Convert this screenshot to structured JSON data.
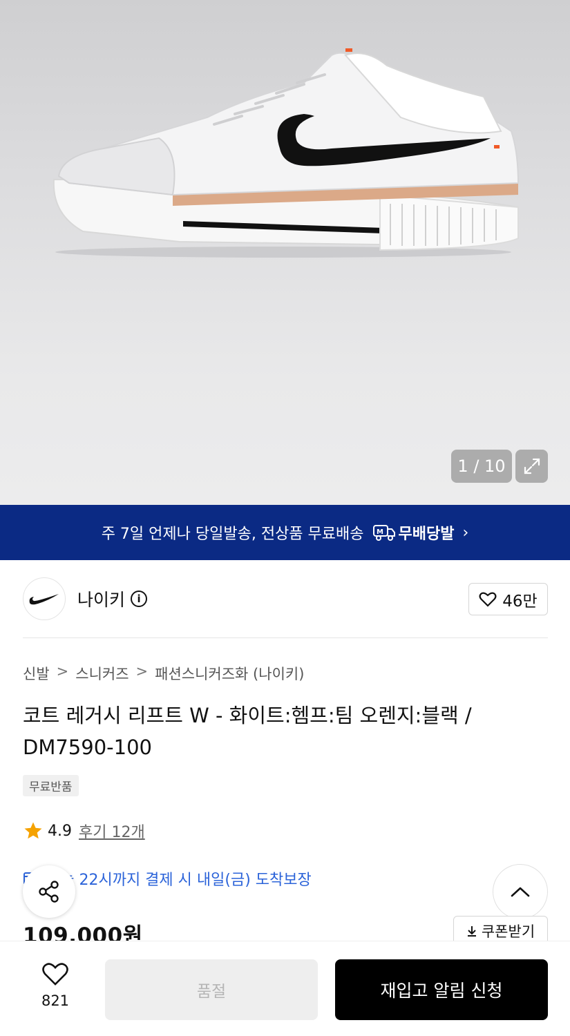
{
  "gallery": {
    "counter": "1 / 10"
  },
  "banner": {
    "text": "주 7일 언제나 당일발송, 전상품 무료배송",
    "brand": "무배당발",
    "chevron": "›"
  },
  "brand": {
    "name": "나이키",
    "info_icon": "i",
    "likes": "46만"
  },
  "breadcrumb": {
    "items": [
      "신발",
      "스니커즈",
      "패션스니커즈화 (나이키)"
    ],
    "separator": ">"
  },
  "product": {
    "title": "코트 레거시 리프트 W - 화이트:헴프:팀 오렌지:블랙 / DM7590-100",
    "tag": "무료반품",
    "rating": "4.9",
    "reviews": "후기 12개",
    "delivery": "오늘 22시까지 결제 시 내일(금) 도착보장",
    "price": "109,000원",
    "coupon": "쿠폰받기"
  },
  "bottom": {
    "wish_count": "821",
    "soldout_label": "품절",
    "restock_label": "재입고 알림 신청"
  },
  "colors": {
    "banner_bg": "#0b2a84",
    "accent_blue": "#2b63d9",
    "star": "#f5a200"
  }
}
